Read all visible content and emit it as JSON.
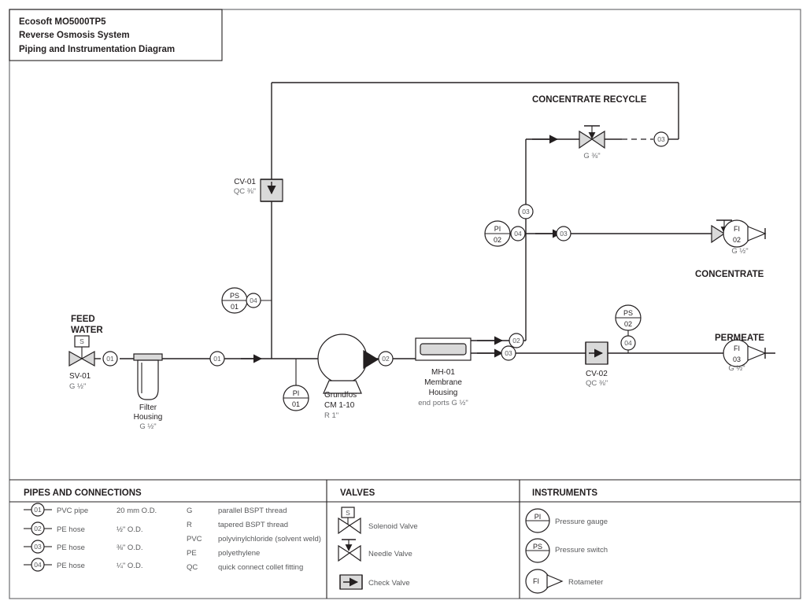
{
  "title_block": {
    "line1": "Ecosoft MO5000TP5",
    "line2": "Reverse Osmosis System",
    "line3": "Piping and Instrumentation Diagram"
  },
  "flow_labels": {
    "feed_water_l1": "FEED",
    "feed_water_l2": "WATER",
    "concentrate_recycle": "CONCENTRATE RECYCLE",
    "concentrate": "CONCENTRATE",
    "permeate": "PERMEATE"
  },
  "equipment": {
    "sv01": {
      "tag": "SV-01",
      "size": "G ½\""
    },
    "filter": {
      "l1": "Filter",
      "l2": "Housing",
      "size": "G ½\""
    },
    "pump": {
      "l1": "Grundfos",
      "l2": "CM 1-10",
      "size": "R 1\""
    },
    "membrane": {
      "tag": "MH-01",
      "l1": "Membrane",
      "l2": "Housing",
      "ports": "end ports G ½\""
    },
    "cv01": {
      "tag": "CV-01",
      "size": "QC ⅜\""
    },
    "cv02": {
      "tag": "CV-02",
      "size": "QC ⅜\""
    },
    "recycle_valve": {
      "size": "G ⅜\""
    },
    "concentrate_valve": {
      "size": "G ½\""
    },
    "permeate_size": "G ½\""
  },
  "instruments": {
    "pi01": {
      "type": "PI",
      "num": "01"
    },
    "pi02": {
      "type": "PI",
      "num": "02"
    },
    "ps01": {
      "type": "PS",
      "num": "01"
    },
    "ps02": {
      "type": "PS",
      "num": "02"
    },
    "fi02": {
      "type": "FI",
      "num": "02"
    },
    "fi03": {
      "type": "FI",
      "num": "03"
    }
  },
  "line_tags": {
    "t01a": "01",
    "t01b": "01",
    "t02a": "02",
    "t02b": "02",
    "t03a": "03",
    "t03b": "03",
    "t03c": "03",
    "t03d": "03",
    "t04a": "04",
    "t04b": "04",
    "t04c": "04"
  },
  "legend": {
    "pipes": {
      "header": "PIPES AND CONNECTIONS",
      "rows": [
        {
          "tag": "01",
          "name": "PVC pipe",
          "size": "20 mm O.D."
        },
        {
          "tag": "02",
          "name": "PE hose",
          "size": "½\" O.D."
        },
        {
          "tag": "03",
          "name": "PE hose",
          "size": "⅜\" O.D."
        },
        {
          "tag": "04",
          "name": "PE hose",
          "size": "¼\" O.D."
        }
      ],
      "abbrev": [
        {
          "code": "G",
          "meaning": "parallel BSPT thread"
        },
        {
          "code": "R",
          "meaning": "tapered BSPT thread"
        },
        {
          "code": "PVC",
          "meaning": "polyvinylchloride (solvent weld)"
        },
        {
          "code": "PE",
          "meaning": "polyethylene"
        },
        {
          "code": "QC",
          "meaning": "quick connect collet fitting"
        }
      ]
    },
    "valves": {
      "header": "VALVES",
      "rows": [
        {
          "label": "Solenoid Valve",
          "badge": "S"
        },
        {
          "label": "Needle Valve",
          "badge": ""
        },
        {
          "label": "Check Valve",
          "badge": ""
        }
      ]
    },
    "instruments": {
      "header": "INSTRUMENTS",
      "rows": [
        {
          "code": "PI",
          "label": "Pressure gauge"
        },
        {
          "code": "PS",
          "label": "Pressure switch"
        },
        {
          "code": "FI",
          "label": "Rotameter"
        }
      ]
    }
  },
  "colors": {
    "stroke": "#231f20",
    "muted": "#58595b",
    "fill_gray": "#d9d9d9",
    "frame": "#6d6e71"
  }
}
